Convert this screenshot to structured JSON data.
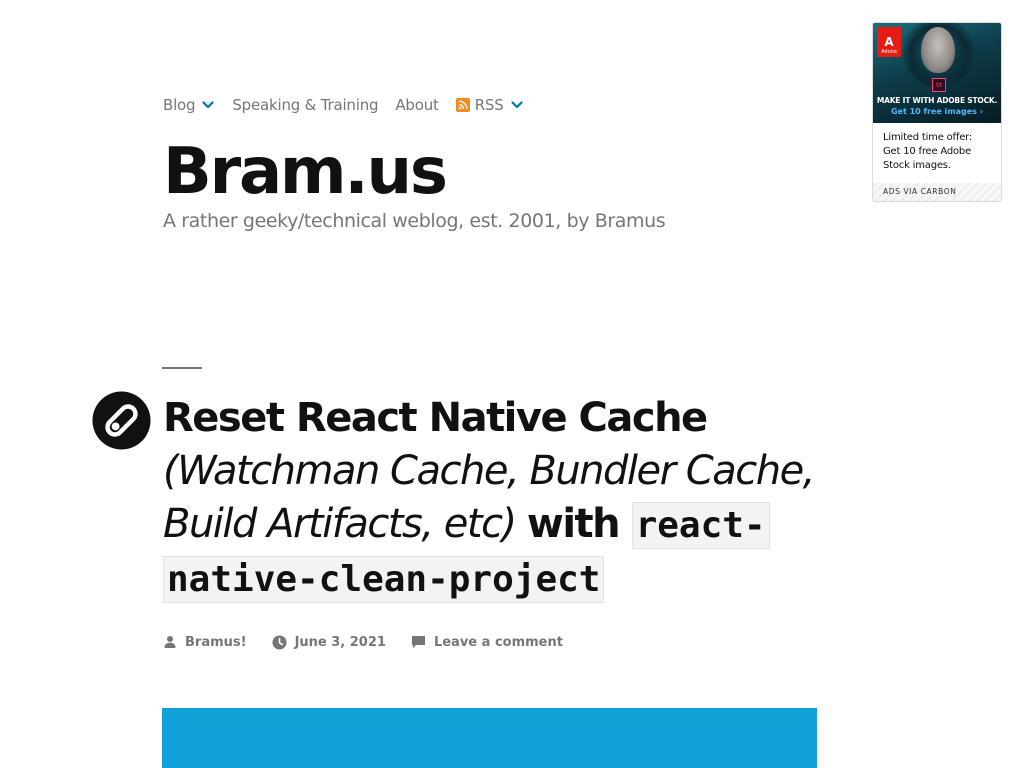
{
  "nav": {
    "blog_label": "Blog",
    "speaking_label": "Speaking & Training",
    "about_label": "About",
    "rss_label": "RSS"
  },
  "site": {
    "title": "Bram.us",
    "description": "A rather geeky/technical weblog, est. 2001, by Bramus"
  },
  "ad": {
    "brand": "Adobe",
    "stock_mark": "St",
    "headline": "MAKE IT WITH ADOBE STOCK.",
    "cta": "Get 10 free images ›",
    "text": "Limited time offer: Get 10 free Adobe Stock images.",
    "via": "ADS VIA CARBON"
  },
  "post": {
    "title_bold": "Reset React Native Cache ",
    "title_light": "(Watchman Cache, Bundler Cache, Build Artifacts, etc) ",
    "title_with": "with ",
    "title_code": "react-native-clean-project",
    "author": "Bramus!",
    "date": "June 3, 2021",
    "comments": "Leave a comment"
  },
  "colors": {
    "accent": "#0073aa",
    "rss": "#f68a1f",
    "featured_bg": "#12a1d6",
    "meta_gray": "#767676"
  },
  "icons": {
    "nav_chevron": "chevron-down-icon",
    "rss": "rss-icon",
    "format": "link-format-icon",
    "author": "person-icon",
    "date": "clock-icon",
    "comment": "comment-icon"
  }
}
